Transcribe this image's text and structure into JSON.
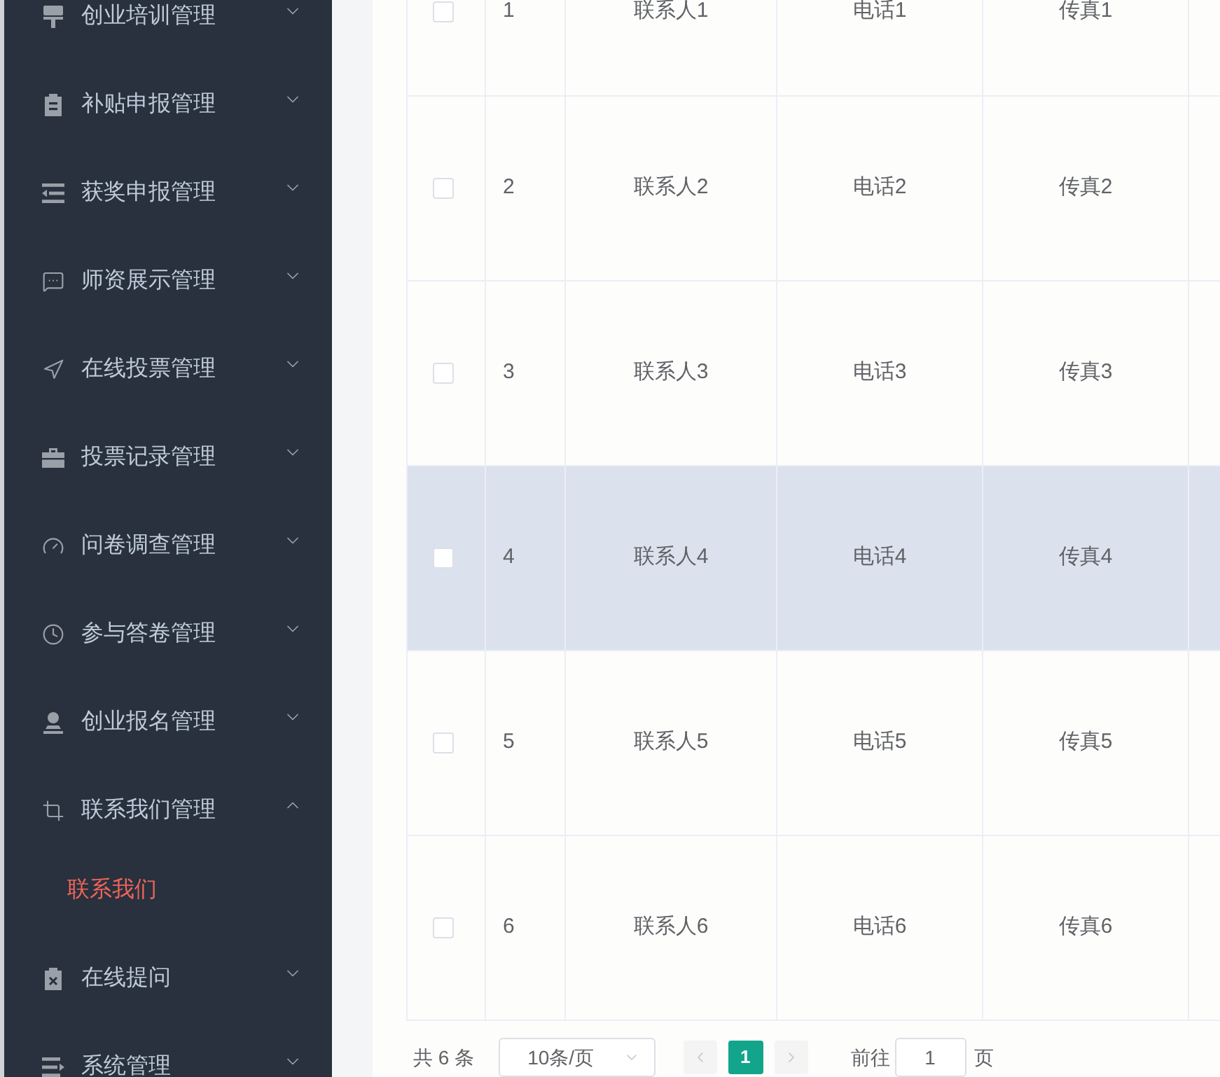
{
  "sidebar": {
    "items": [
      {
        "label": "创业培训管理",
        "expanded": false
      },
      {
        "label": "补贴申报管理",
        "expanded": false
      },
      {
        "label": "获奖申报管理",
        "expanded": false
      },
      {
        "label": "师资展示管理",
        "expanded": false
      },
      {
        "label": "在线投票管理",
        "expanded": false
      },
      {
        "label": "投票记录管理",
        "expanded": false
      },
      {
        "label": "问卷调查管理",
        "expanded": false
      },
      {
        "label": "参与答卷管理",
        "expanded": false
      },
      {
        "label": "创业报名管理",
        "expanded": false
      },
      {
        "label": "联系我们管理",
        "expanded": true,
        "children": [
          {
            "label": "联系我们",
            "selected": true
          }
        ]
      },
      {
        "label": "在线提问",
        "expanded": false
      },
      {
        "label": "系统管理",
        "expanded": false
      }
    ]
  },
  "table": {
    "rows": [
      {
        "checked": false,
        "highlighted": false,
        "index": "1",
        "contact": "联系人1",
        "phone": "电话1",
        "fax": "传真1"
      },
      {
        "checked": false,
        "highlighted": false,
        "index": "2",
        "contact": "联系人2",
        "phone": "电话2",
        "fax": "传真2"
      },
      {
        "checked": false,
        "highlighted": false,
        "index": "3",
        "contact": "联系人3",
        "phone": "电话3",
        "fax": "传真3"
      },
      {
        "checked": false,
        "highlighted": true,
        "index": "4",
        "contact": "联系人4",
        "phone": "电话4",
        "fax": "传真4"
      },
      {
        "checked": false,
        "highlighted": false,
        "index": "5",
        "contact": "联系人5",
        "phone": "电话5",
        "fax": "传真5"
      },
      {
        "checked": false,
        "highlighted": false,
        "index": "6",
        "contact": "联系人6",
        "phone": "电话6",
        "fax": "传真6"
      }
    ]
  },
  "pagination": {
    "total": "共 6 条",
    "page_size": "10条/页",
    "prev": {
      "disabled": true
    },
    "pages": [
      {
        "label": "1",
        "selected": true
      }
    ],
    "next": {
      "disabled": true
    },
    "goto_label": "前往",
    "goto_value": "1",
    "goto_suffix": "页"
  }
}
